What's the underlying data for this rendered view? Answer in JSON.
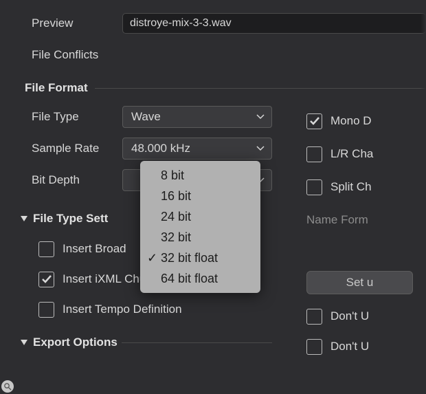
{
  "preview": {
    "label": "Preview",
    "value": "distroye-mix-3-3.wav"
  },
  "file_conflicts": {
    "label": "File Conflicts"
  },
  "sections": {
    "file_format": "File Format",
    "file_type_settings": "File Type Sett",
    "export_options": "Export Options"
  },
  "fields": {
    "file_type": {
      "label": "File Type",
      "value": "Wave"
    },
    "sample_rate": {
      "label": "Sample Rate",
      "value": "48.000 kHz"
    },
    "bit_depth": {
      "label": "Bit Depth",
      "selected": "32 bit float",
      "options": [
        "8 bit",
        "16 bit",
        "24 bit",
        "32 bit",
        "32 bit float",
        "64 bit float"
      ]
    }
  },
  "right_checks": {
    "mono": {
      "label": "Mono D",
      "checked": true
    },
    "lr": {
      "label": "L/R Cha",
      "checked": false
    },
    "split": {
      "label": "Split Ch",
      "checked": false
    },
    "name_format": "Name Form"
  },
  "file_type_checks": {
    "broadcast": {
      "label": "Insert Broad",
      "checked": false
    },
    "ixml": {
      "label": "Insert iXML Chunk",
      "checked": true
    },
    "tempo": {
      "label": "Insert Tempo Definition",
      "checked": false
    }
  },
  "setup_button": "Set u",
  "dont_use": {
    "a": "Don't U",
    "b": "Don't U"
  }
}
